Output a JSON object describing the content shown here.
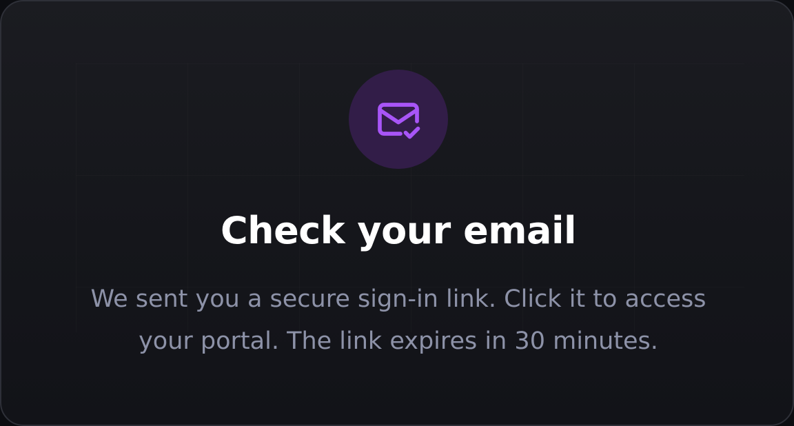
{
  "dialog": {
    "icon": "mail-check-icon",
    "title": "Check your email",
    "message": "We sent you a secure sign-in link. Click it to access your portal. The link expires in 30 minutes."
  },
  "colors": {
    "background": "#15161b",
    "border": "#2e3038",
    "icon_circle": "#321d48",
    "icon_stroke": "#a855f7",
    "title_text": "#ffffff",
    "body_text": "#8d92a8"
  }
}
